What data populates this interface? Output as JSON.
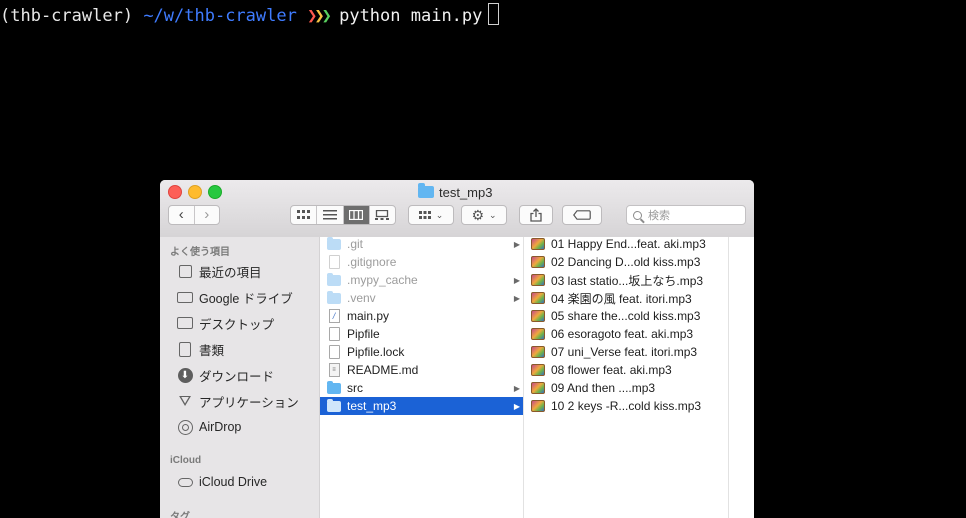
{
  "terminal": {
    "env": "(thb-crawler)",
    "path": "~/w/thb-crawler",
    "command": "python main.py"
  },
  "window": {
    "title": "test_mp3",
    "toolbar": {
      "back_glyph": "‹",
      "forward_glyph": "›",
      "view_modes": [
        "icon",
        "list",
        "column",
        "gallery"
      ],
      "active_view": "column",
      "search_placeholder": "検索"
    }
  },
  "sidebar": {
    "favorites_header": "よく使う項目",
    "favorites": [
      {
        "label": "最近の項目",
        "icon": "recents-icon"
      },
      {
        "label": "Google ドライブ",
        "icon": "folder-icon"
      },
      {
        "label": "デスクトップ",
        "icon": "desktop-icon"
      },
      {
        "label": "書類",
        "icon": "documents-icon"
      },
      {
        "label": "ダウンロード",
        "icon": "downloads-icon"
      },
      {
        "label": "アプリケーション",
        "icon": "applications-icon"
      },
      {
        "label": "AirDrop",
        "icon": "airdrop-icon"
      }
    ],
    "icloud_header": "iCloud",
    "icloud": [
      {
        "label": "iCloud Drive",
        "icon": "cloud-icon"
      }
    ],
    "tags_header": "タグ"
  },
  "column1": [
    {
      "name": ".git",
      "kind": "folder",
      "hidden": true,
      "has_children": true
    },
    {
      "name": ".gitignore",
      "kind": "file",
      "hidden": true,
      "has_children": false
    },
    {
      "name": ".mypy_cache",
      "kind": "folder",
      "hidden": true,
      "has_children": true
    },
    {
      "name": ".venv",
      "kind": "folder",
      "hidden": true,
      "has_children": true
    },
    {
      "name": "main.py",
      "kind": "python",
      "hidden": false,
      "has_children": false
    },
    {
      "name": "Pipfile",
      "kind": "file",
      "hidden": false,
      "has_children": false
    },
    {
      "name": "Pipfile.lock",
      "kind": "file",
      "hidden": false,
      "has_children": false
    },
    {
      "name": "README.md",
      "kind": "markdown",
      "hidden": false,
      "has_children": false
    },
    {
      "name": "src",
      "kind": "folder",
      "hidden": false,
      "has_children": true
    },
    {
      "name": "test_mp3",
      "kind": "folder",
      "hidden": false,
      "has_children": true,
      "selected": true
    }
  ],
  "column2": [
    "01 Happy End...feat. aki.mp3",
    "02 Dancing D...old kiss.mp3",
    "03 last statio...坂上なち.mp3",
    "04 楽園の風 feat. itori.mp3",
    "05 share the...cold kiss.mp3",
    "06 esoragoto feat. aki.mp3",
    "07 uni_Verse feat. itori.mp3",
    "08 flower feat. aki.mp3",
    "09 And then ....mp3",
    "10 2 keys -R...cold kiss.mp3"
  ],
  "colors": {
    "selection": "#1b62d6",
    "folder": "#62b6f1",
    "terminal_path": "#3f7cff"
  }
}
